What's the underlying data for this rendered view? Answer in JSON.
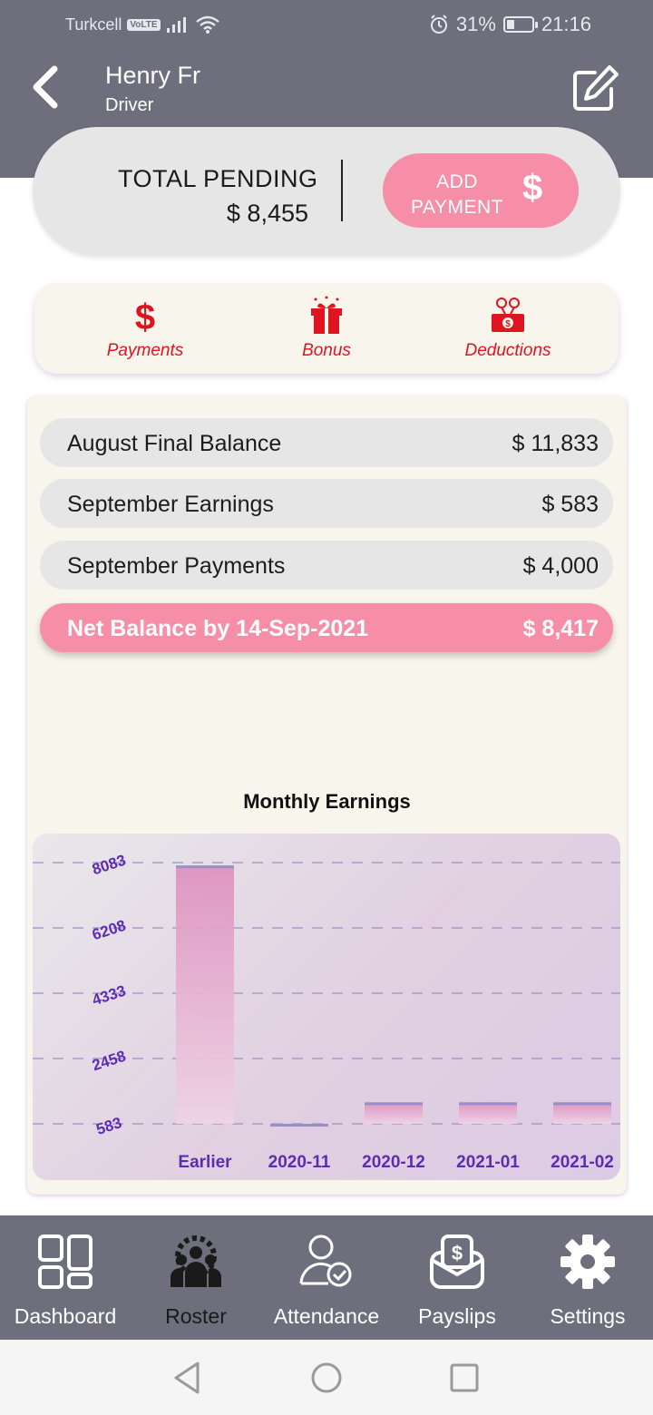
{
  "status_bar": {
    "carrier": "Turkcell",
    "network_badge": "VoLTE",
    "battery": "31%",
    "time": "21:16",
    "battery_level": 0.31
  },
  "header": {
    "name": "Henry Fr",
    "role": "Driver",
    "back_icon": "chevron-left-icon",
    "edit_icon": "edit-icon"
  },
  "pending": {
    "label": "TOTAL PENDING",
    "value": "$ 8,455",
    "add_payment_label": "ADD PAYMENT",
    "add_payment_symbol": "$"
  },
  "categories": [
    {
      "label": "Payments",
      "icon": "dollar-icon"
    },
    {
      "label": "Bonus",
      "icon": "gift-icon"
    },
    {
      "label": "Deductions",
      "icon": "money-out-icon"
    }
  ],
  "summary": {
    "august_label": "August Final Balance",
    "august_value": "$ 11,833",
    "earnings_label": "September Earnings",
    "earnings_value": "$ 583",
    "payments_label": "September Payments",
    "payments_value": "$ 4,000",
    "net_label": "Net Balance by 14-Sep-2021",
    "net_value": "$ 8,417"
  },
  "chart_data": {
    "type": "bar",
    "title": "Monthly Earnings",
    "categories": [
      "Earlier",
      "2020-11",
      "2020-12",
      "2021-01",
      "2021-02"
    ],
    "values": [
      8000,
      500,
      1200,
      1200,
      1200
    ],
    "yticks": [
      "8083",
      "6208",
      "4333",
      "2458",
      "583"
    ],
    "ytick_values": [
      8083,
      6208,
      4333,
      2458,
      583
    ],
    "ylim": [
      583,
      8083
    ],
    "grid": true,
    "bar_color": "#dd8fbd",
    "tick_color": "#5d2db0"
  },
  "nav": [
    {
      "label": "Dashboard",
      "icon": "dashboard-icon"
    },
    {
      "label": "Roster",
      "icon": "roster-icon"
    },
    {
      "label": "Attendance",
      "icon": "attendance-icon"
    },
    {
      "label": "Payslips",
      "icon": "payslip-icon"
    },
    {
      "label": "Settings",
      "icon": "gear-icon"
    }
  ],
  "colors": {
    "header": "#6f6e7d",
    "accent_pink": "#f78ea8",
    "category_red": "#e0141e",
    "panel": "#f7f5ec"
  }
}
